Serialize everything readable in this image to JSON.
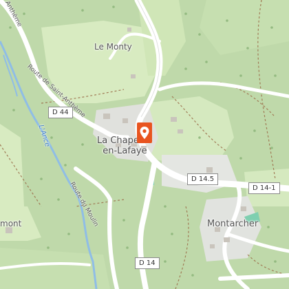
{
  "labels": {
    "le_monty": "Le Monty",
    "village_line1": "La Chapelle-",
    "village_line2": "en-Lafaye",
    "montarcher": "Montarcher",
    "left_edge": "mont",
    "road_saint_antheme": "Route de Saint-Anthème",
    "road_moulin": "Route du Moulin",
    "river": "L'Ance",
    "top_left_cut": "Anthème"
  },
  "road_shields": {
    "d44": "D 44",
    "d14_5": "D 14.5",
    "d14_1": "D 14-1",
    "d14": "D 14"
  },
  "marker": {
    "icon": "map-pin-icon",
    "color": "#e8541f"
  },
  "colors": {
    "forest": "#b8d4a4",
    "meadow": "#d9ecc3",
    "water": "#a4c8ea",
    "road": "#ffffff",
    "path": "#a07a55"
  }
}
